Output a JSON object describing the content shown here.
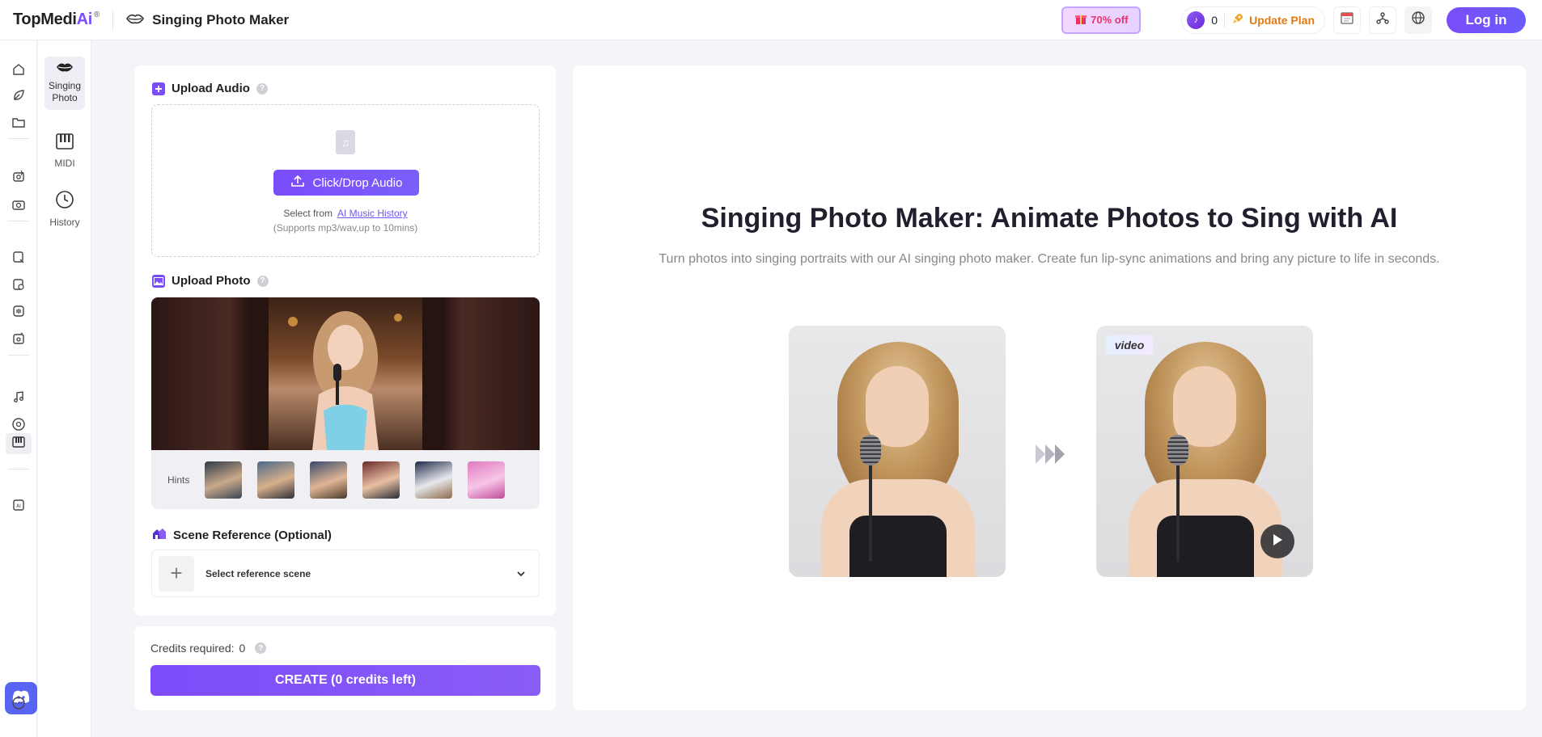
{
  "header": {
    "logo_main": "TopMedi",
    "logo_ai": "Ai",
    "logo_reg": "®",
    "app_title": "Singing Photo Maker",
    "promo_label": "70% off",
    "credits_count": "0",
    "update_plan_label": "Update Plan",
    "login_label": "Log in"
  },
  "subnav": {
    "items": [
      {
        "label": "Singing Photo",
        "icon": "lips-icon"
      },
      {
        "label": "MIDI",
        "icon": "piano-icon"
      },
      {
        "label": "History",
        "icon": "clock-icon"
      }
    ]
  },
  "upload_audio": {
    "title": "Upload Audio",
    "button_label": "Click/Drop Audio",
    "select_from": "Select from",
    "history_link": "AI Music History",
    "supports": "(Supports mp3/wav,up to 10mins)"
  },
  "upload_photo": {
    "title": "Upload Photo",
    "hints_label": "Hints"
  },
  "scene_reference": {
    "title": "Scene Reference (Optional)",
    "placeholder": "Select reference scene"
  },
  "credits": {
    "label": "Credits required:",
    "value": "0",
    "create_label": "CREATE (0 credits left)"
  },
  "hero": {
    "title": "Singing Photo Maker: Animate Photos to Sing with AI",
    "subtitle": "Turn photos into singing portraits with our AI singing photo maker. Create fun lip-sync animations and bring any picture to life in seconds.",
    "video_tag": "video"
  },
  "colors": {
    "accent": "#7a4dfb",
    "update_plan": "#e07a10",
    "discord": "#5865f2"
  }
}
